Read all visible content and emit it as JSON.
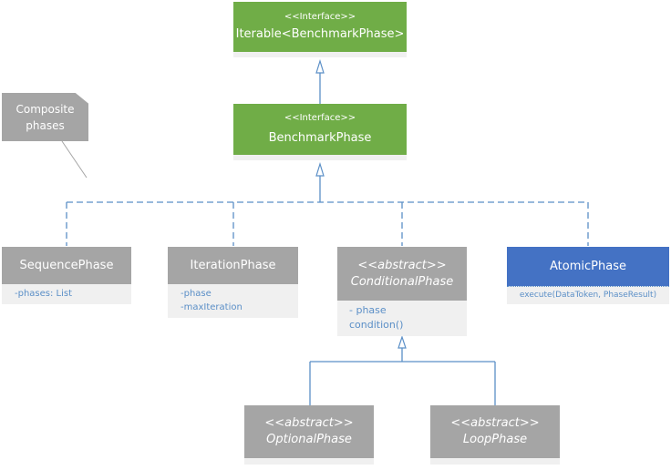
{
  "diagram": {
    "note": {
      "text": "Composite phases",
      "line1": "Composite",
      "line2": "phases"
    },
    "colors": {
      "interface": "#70ad47",
      "class": "#a5a5a5",
      "atomic": "#4472c4",
      "connector": "#5b8fc7",
      "attr_text": "#5b8fc7",
      "body": "#f0f0f0"
    },
    "classes": {
      "iterable": {
        "stereotype": "<<Interface>>",
        "name": "Iterable<BenchmarkPhase>"
      },
      "benchmark_phase": {
        "stereotype": "<<Interface>>",
        "name": "BenchmarkPhase"
      },
      "sequence_phase": {
        "name": "SequencePhase",
        "attributes": [
          "-phases: List"
        ]
      },
      "iteration_phase": {
        "name": "IterationPhase",
        "attributes": [
          "-phase",
          "-maxIteration"
        ]
      },
      "conditional_phase": {
        "stereotype": "<<abstract>>",
        "name": "ConditionalPhase",
        "attributes": [
          "- phase",
          "condition()"
        ]
      },
      "atomic_phase": {
        "name": "AtomicPhase",
        "methods": [
          "execute(DataToken, PhaseResult)"
        ]
      },
      "optional_phase": {
        "stereotype": "<<abstract>>",
        "name": "OptionalPhase"
      },
      "loop_phase": {
        "stereotype": "<<abstract>>",
        "name": "LoopPhase"
      }
    },
    "relations": [
      {
        "from": "BenchmarkPhase",
        "to": "Iterable<BenchmarkPhase>",
        "type": "generalization"
      },
      {
        "from": "SequencePhase",
        "to": "BenchmarkPhase",
        "type": "realization"
      },
      {
        "from": "IterationPhase",
        "to": "BenchmarkPhase",
        "type": "realization"
      },
      {
        "from": "ConditionalPhase",
        "to": "BenchmarkPhase",
        "type": "realization"
      },
      {
        "from": "AtomicPhase",
        "to": "BenchmarkPhase",
        "type": "realization"
      },
      {
        "from": "OptionalPhase",
        "to": "ConditionalPhase",
        "type": "generalization"
      },
      {
        "from": "LoopPhase",
        "to": "ConditionalPhase",
        "type": "generalization"
      }
    ]
  }
}
